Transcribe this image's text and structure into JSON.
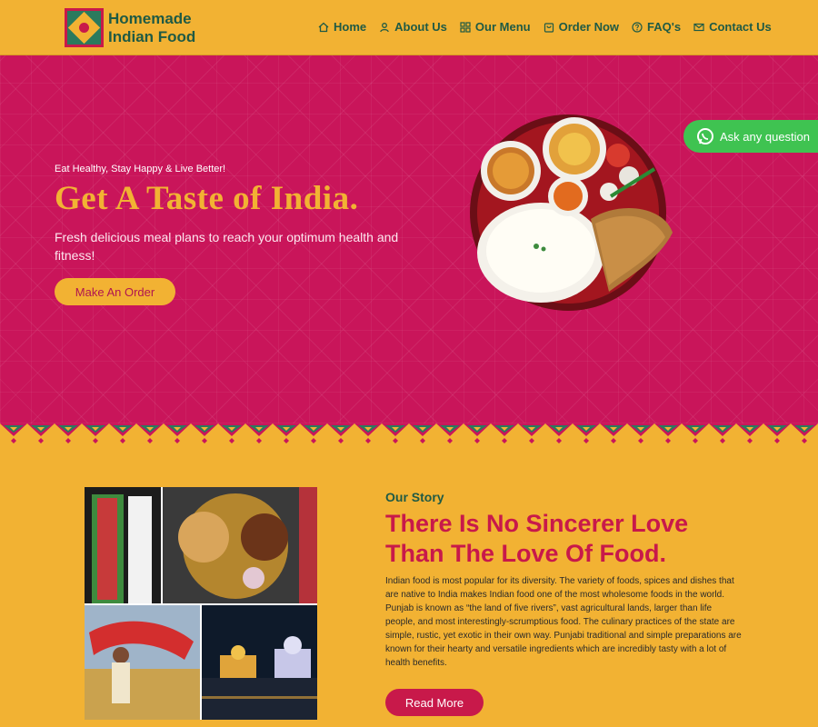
{
  "brand": {
    "line1": "Homemade",
    "line2": "Indian Food"
  },
  "nav": [
    {
      "label": "Home",
      "icon": "home-icon"
    },
    {
      "label": "About Us",
      "icon": "user-icon"
    },
    {
      "label": "Our Menu",
      "icon": "grid-icon"
    },
    {
      "label": "Order Now",
      "icon": "bag-icon"
    },
    {
      "label": "FAQ's",
      "icon": "question-icon"
    },
    {
      "label": "Contact Us",
      "icon": "mail-icon"
    }
  ],
  "hero": {
    "tagline": "Eat Healthy, Stay Happy & Live Better!",
    "title": "Get A Taste of India.",
    "subtitle": "Fresh delicious meal plans to reach your optimum health and fitness!",
    "cta": "Make An Order"
  },
  "whatsapp": {
    "label": "Ask any question",
    "icon": "whatsapp-icon"
  },
  "story": {
    "kicker": "Our Story",
    "title": "There Is No Sincerer Love Than The Love Of Food.",
    "body": "Indian food is most popular for its diversity. The variety of foods, spices and dishes that are native to India makes Indian food one of the most wholesome foods in the world. Punjab is known as “the land of five rivers”, vast agricultural lands, larger than life people, and most interestingly-scrumptious food. The culinary practices of the state are simple, rustic, yet exotic in their own way. Punjabi traditional and simple preparations are known for their hearty and versatile ingredients which are incredibly tasty with a lot of health benefits.",
    "button": "Read More"
  },
  "colors": {
    "mustard": "#f2b233",
    "magenta": "#c9155a",
    "green": "#1f5a44",
    "whatsapp": "#3fc351"
  }
}
